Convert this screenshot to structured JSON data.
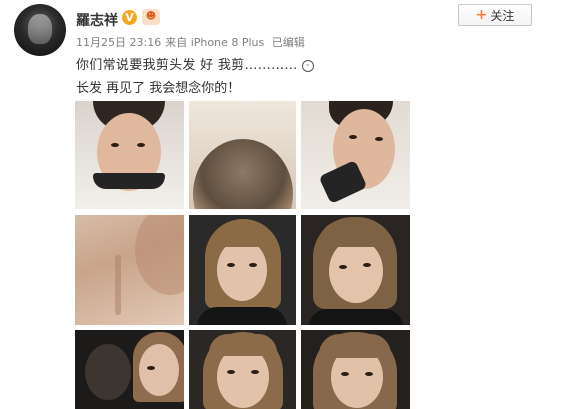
{
  "post": {
    "username": "羅志祥",
    "verified_badge": "V",
    "follow_button": {
      "plus": "+",
      "label": "关注"
    },
    "meta": {
      "time": "11月25日 23:16",
      "via_prefix": "来自",
      "device": "iPhone 8 Plus",
      "edited": "已编辑"
    },
    "text_line1": "你们常说要我剪头发 好 我剪…………",
    "text_line2": "长发 再见了 我会想念你的！"
  },
  "icons": {
    "avatar": "lion-avatar",
    "verified": "verified-v-icon",
    "member": "member-crown-icon",
    "emoji": "grin-emoji-icon"
  },
  "colors": {
    "accent_orange": "#fa7d3c",
    "verified_gold": "#f5a623",
    "meta_gray": "#808080",
    "text": "#333333"
  },
  "photos": [
    "photo-1-short-hair-mask",
    "photo-2-buzzcut-top",
    "photo-3-mask-side",
    "photo-4-neck-closeup",
    "photo-5-long-hair-selfie",
    "photo-6-long-hair-smile",
    "photo-7-two-people",
    "photo-8-long-hair-squint",
    "photo-9-long-hair-front"
  ]
}
